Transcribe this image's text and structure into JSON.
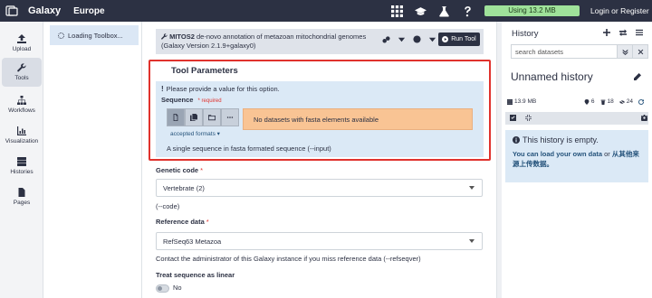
{
  "topbar": {
    "brand": "Galaxy",
    "subtitle": "Europe",
    "usage": "Using 13.2 MB",
    "login": "Login or Register",
    "icons": [
      "grid-icon",
      "graduation-cap-icon",
      "flask-icon",
      "question-icon"
    ]
  },
  "activity": {
    "items": [
      {
        "label": "Upload",
        "icon": "upload-icon"
      },
      {
        "label": "Tools",
        "icon": "wrench-icon",
        "active": true
      },
      {
        "label": "Workflows",
        "icon": "sitemap-icon"
      },
      {
        "label": "Visualization",
        "icon": "chart-icon"
      },
      {
        "label": "Histories",
        "icon": "database-icon"
      },
      {
        "label": "Pages",
        "icon": "file-icon"
      }
    ]
  },
  "toolpanel": {
    "loading": "Loading Toolbox..."
  },
  "tool": {
    "name": "MITOS2",
    "description": "de-novo annotation of metazoan mitochondrial genomes",
    "version": "(Galaxy Version 2.1.9+galaxy0)",
    "run_label": "Run Tool",
    "params_title": "Tool Parameters",
    "warning": "Please provide a value for this option.",
    "sequence_label": "Sequence",
    "required_label": "required",
    "no_data": "No datasets with fasta elements available",
    "accepted_formats": "accepted formats",
    "sequence_help": "A single sequence in fasta formated sequence (--input)",
    "genetic_code_label": "Genetic code",
    "genetic_code_value": "Vertebrate (2)",
    "genetic_code_help": "(--code)",
    "reference_label": "Reference data",
    "reference_value": "RefSeq63 Metazoa",
    "reference_help": "Contact the administrator of this Galaxy instance if you miss reference data (--refseqver)",
    "linear_label": "Treat sequence as linear",
    "linear_value": "No"
  },
  "history": {
    "title": "History",
    "search_placeholder": "search datasets",
    "name": "Unnamed history",
    "size": "13.9 MB",
    "counts": {
      "shown": "6",
      "deleted": "18",
      "hidden": "24"
    },
    "empty_title": "This history is empty.",
    "empty_text_1": "You can load your own data",
    "empty_text_2": "or",
    "empty_text_3": "从其他来源上传数据。"
  },
  "colors": {
    "navbar": "#2c3143",
    "usage_bar": "#9fe29a",
    "highlight_border": "#e0322d",
    "info_bg": "#dbe9f6",
    "warning_bg": "#f9c494"
  }
}
